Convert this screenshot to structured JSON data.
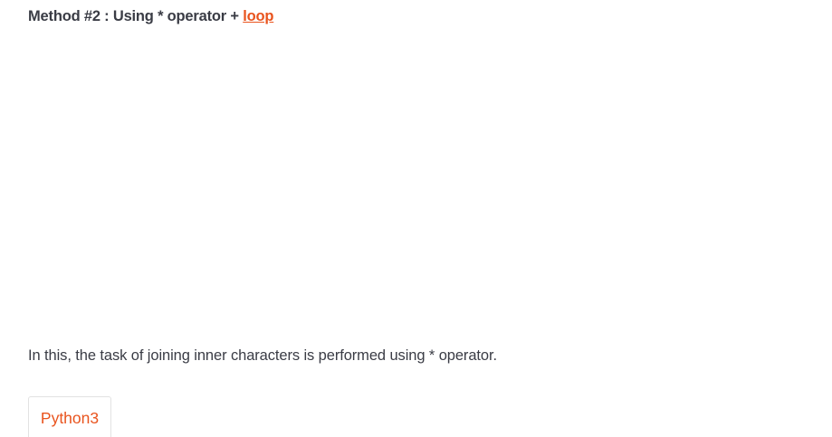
{
  "heading": {
    "prefix": "Method #2 : Using * operator + ",
    "link": "loop"
  },
  "paragraph": "In this, the task of joining inner characters is performed using * operator.",
  "code_tab": {
    "label": "Python3"
  },
  "colors": {
    "accent": "#e9541e",
    "text": "#3a3c45"
  }
}
